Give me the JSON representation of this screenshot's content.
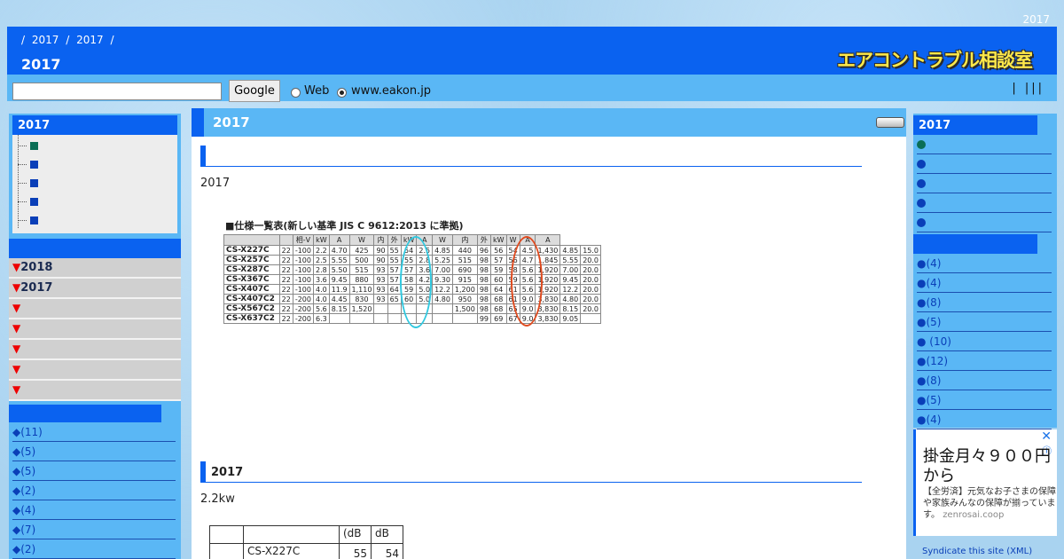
{
  "header": {
    "top_year": "2017",
    "breadcrumb": [
      "/",
      "2017",
      "/",
      "2017",
      "/"
    ],
    "page_title": "2017",
    "logo_text": "エアコントラブル相談室"
  },
  "search": {
    "button_label": "Google",
    "radio_web": "Web",
    "radio_site": "www.eakon.jp",
    "right_links": "|  |||"
  },
  "left": {
    "box_title": "2017",
    "tree_count": 5,
    "archives": [
      {
        "tri": "▼",
        "label": "2018"
      },
      {
        "tri": "▼",
        "label": "2017"
      },
      {
        "tri": "▼",
        "label": ""
      },
      {
        "tri": "▼",
        "label": ""
      },
      {
        "tri": "▼",
        "label": ""
      },
      {
        "tri": "▼",
        "label": ""
      },
      {
        "tri": "▼",
        "label": ""
      }
    ],
    "categories": [
      "◆(11)",
      "◆(5)",
      "◆(5)",
      "◆(2)",
      "◆(4)",
      "◆(7)",
      "◆(2)"
    ]
  },
  "main": {
    "title": "2017",
    "intro": "2017",
    "section_title": "2017",
    "section_text": "2.2kw",
    "spec": {
      "caption": "■仕様一覧表(新しい基準 JIS C 9612:2013 に準拠)",
      "header_units": [
        "",
        "",
        "相-V",
        "kW",
        "A",
        "W",
        "内",
        "外",
        "kW",
        "A",
        "W",
        "内",
        "外",
        "kW",
        "W",
        "A",
        "A"
      ],
      "rows": [
        [
          "CS-X227C",
          "22",
          "-100",
          "2.2",
          "4.70",
          "425",
          "90",
          "55",
          "54",
          "2.5",
          "4.85",
          "440",
          "96",
          "56",
          "54",
          "4.5",
          "1,430",
          "4.85",
          "15.0"
        ],
        [
          "CS-X257C",
          "22",
          "-100",
          "2.5",
          "5.55",
          "500",
          "90",
          "55",
          "55",
          "2.8",
          "5.25",
          "515",
          "98",
          "57",
          "56",
          "4.7",
          "1,845",
          "5.55",
          "20.0"
        ],
        [
          "CS-X287C",
          "22",
          "-100",
          "2.8",
          "5.50",
          "515",
          "93",
          "57",
          "57",
          "3.6",
          "7.00",
          "690",
          "98",
          "59",
          "58",
          "5.6",
          "1,920",
          "7.00",
          "20.0"
        ],
        [
          "CS-X367C",
          "22",
          "-100",
          "3.6",
          "9.45",
          "880",
          "93",
          "57",
          "58",
          "4.2",
          "9.30",
          "915",
          "98",
          "60",
          "59",
          "5.6",
          "1,920",
          "9.45",
          "20.0"
        ],
        [
          "CS-X407C",
          "22",
          "-100",
          "4.0",
          "11.9",
          "1,110",
          "93",
          "64",
          "59",
          "5.0",
          "12.2",
          "1,200",
          "98",
          "64",
          "61",
          "5.6",
          "1,920",
          "12.2",
          "20.0"
        ],
        [
          "CS-X407C2",
          "22",
          "-200",
          "4.0",
          "4.45",
          "830",
          "93",
          "65",
          "60",
          "5.0",
          "4.80",
          "950",
          "98",
          "68",
          "61",
          "9.0",
          "3,830",
          "4.80",
          "20.0"
        ],
        [
          "CS-X567C2",
          "22",
          "-200",
          "5.6",
          "8.15",
          "1,520",
          "",
          "",
          "",
          "",
          "",
          "1,500",
          "98",
          "68",
          "65",
          "9.0",
          "3,830",
          "8.15",
          "20.0"
        ],
        [
          "CS-X637C2",
          "22",
          "-200",
          "6.3",
          "",
          "",
          "",
          "",
          "",
          "",
          "",
          "",
          "99",
          "69",
          "67",
          "9.0",
          "3,830",
          "9.05",
          ""
        ]
      ]
    },
    "mini_table": {
      "row1": [
        "",
        "",
        "(dB",
        "dB"
      ],
      "row2": [
        "",
        "CS-X227C",
        "55",
        "54"
      ]
    }
  },
  "right": {
    "box_title": "2017",
    "dot_items": 5,
    "links": [
      "●(4)",
      "●(4)",
      "●(8)",
      "●(5)",
      "● (10)",
      "●(12)",
      "●(8)",
      "●(5)",
      "●(4)"
    ]
  },
  "ad": {
    "close": "✕",
    "info": "ⓘ",
    "headline": "掛金月々９００円から",
    "body": "【全労済】元気なお子さまの保障や家族みんなの保障が揃っています。",
    "domain": "zenrosai.coop"
  },
  "footer": {
    "syndicate": "Syndicate this site (XML)"
  }
}
